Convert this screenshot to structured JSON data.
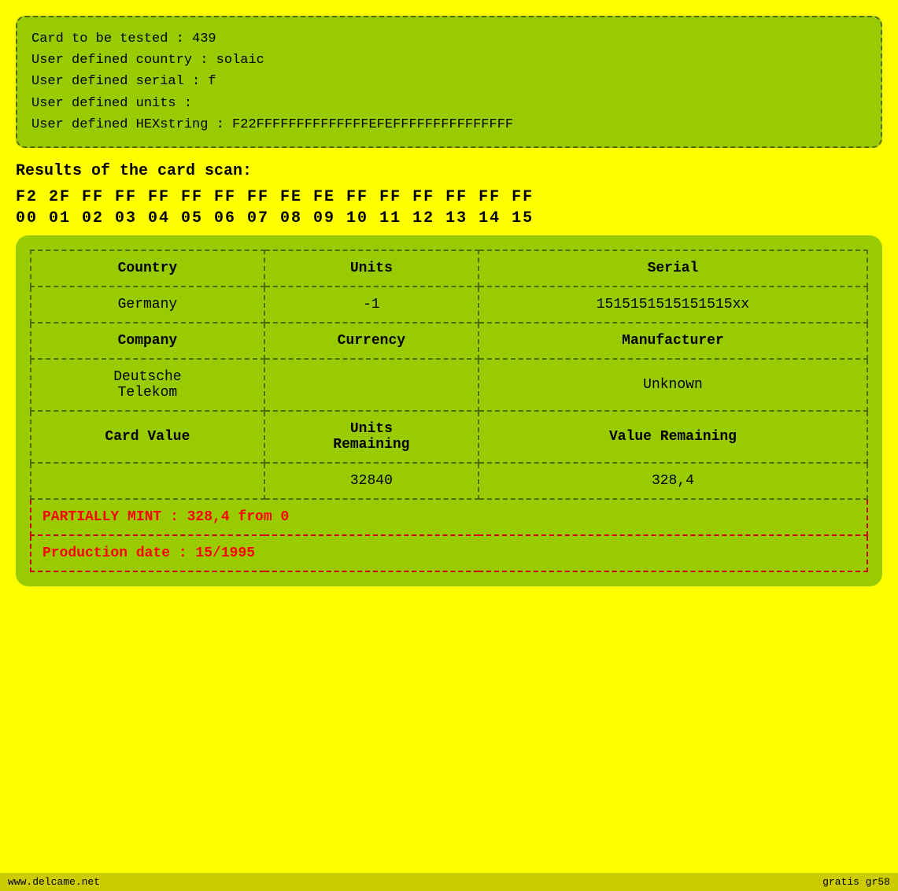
{
  "infoBox": {
    "line1": "Card to be tested : 439",
    "line2": "User defined country : solaic",
    "line3": "User defined serial : f",
    "line4": "User defined units :",
    "line5": "User defined HEXstring : F22FFFFFFFFFFFFFFEFEFFFFFFFFFFFFFFF"
  },
  "scanResults": {
    "label": "Results of the card scan:",
    "hexRow": "F2  2F  FF  FF  FF  FF  FF  FF  FE  FE  FF  FF  FF  FF  FF  FF",
    "indexRow": "00  01  02  03  04  05  06  07  08  09  10  11  12  13  14  15"
  },
  "table": {
    "headers": {
      "country": "Country",
      "units": "Units",
      "serial": "Serial",
      "company": "Company",
      "currency": "Currency",
      "manufacturer": "Manufacturer",
      "cardValue": "Card Value",
      "unitsRemaining": "Units\nRemaining",
      "valueRemaining": "Value Remaining"
    },
    "data": {
      "country": "Germany",
      "units": "-1",
      "serial": "1515151515151515xx",
      "company": "Deutsche\nTelekom",
      "currency": "",
      "manufacturer": "Unknown",
      "cardValue": "",
      "unitsRemaining": "32840",
      "valueRemaining": "328,4"
    },
    "statusMint": "PARTIALLY MINT : 328,4 from 0",
    "statusProduction": "Production date : 15/1995"
  },
  "footer": {
    "left": "www.delcame.net",
    "right": "gratis  gr58"
  }
}
